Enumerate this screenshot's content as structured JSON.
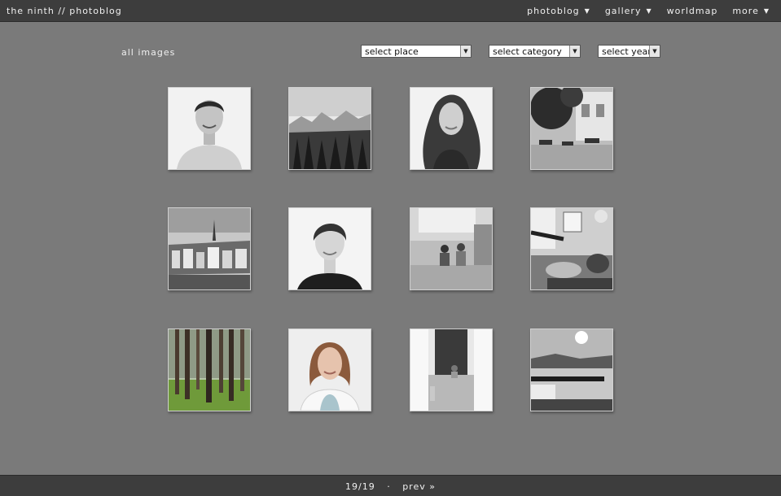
{
  "header": {
    "site_title": "the ninth // photoblog",
    "nav": [
      {
        "label": "photoblog",
        "dropdown": true
      },
      {
        "label": "gallery",
        "dropdown": true
      },
      {
        "label": "worldmap",
        "dropdown": false
      },
      {
        "label": "more",
        "dropdown": true
      }
    ]
  },
  "filters": {
    "heading": "all images",
    "place": "select place",
    "category": "select category",
    "year": "select year"
  },
  "thumbnails": [
    {
      "subject": "portrait-man-smiling"
    },
    {
      "subject": "mountains-and-forest"
    },
    {
      "subject": "portrait-woman-curly-hair"
    },
    {
      "subject": "garden-chess-tables"
    },
    {
      "subject": "city-skyline-river"
    },
    {
      "subject": "portrait-woman-dark-top"
    },
    {
      "subject": "children-in-kitchen"
    },
    {
      "subject": "cat-on-sofa"
    },
    {
      "subject": "green-forest"
    },
    {
      "subject": "portrait-woman-white-jacket"
    },
    {
      "subject": "child-in-hallway"
    },
    {
      "subject": "lake-pier-sunlight"
    }
  ],
  "footer": {
    "page": "19/19",
    "separator": "·",
    "prev_label": "prev »"
  },
  "colors": {
    "background": "#7a7a7a",
    "bar": "#3d3d3d",
    "text": "#f0f0f0"
  }
}
